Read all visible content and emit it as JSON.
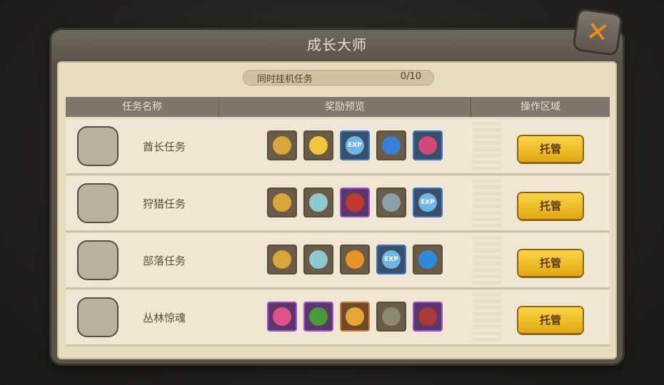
{
  "window": {
    "title": "成长大师"
  },
  "counter": {
    "label": "同时挂机任务",
    "value": "0/10"
  },
  "columns": [
    "任务名称",
    "奖励预览",
    "操作区域"
  ],
  "rows": [
    {
      "name": "酋长任务",
      "portrait_icon": "chief-stone-icon",
      "button": "托管",
      "rewards": [
        {
          "icon": "gold-chest-icon",
          "quality": "brown"
        },
        {
          "icon": "gold-hand-icon",
          "quality": "brown"
        },
        {
          "icon": "exp-heart-icon",
          "quality": "blue",
          "text": "EXP"
        },
        {
          "icon": "blue-feather-icon",
          "quality": "brown"
        },
        {
          "icon": "flower-gem-icon",
          "quality": "blue"
        }
      ]
    },
    {
      "name": "狩猎任务",
      "portrait_icon": "hunter-skull-icon",
      "button": "托管",
      "rewards": [
        {
          "icon": "gold-chest-icon",
          "quality": "brown"
        },
        {
          "icon": "shell-icon",
          "quality": "brown"
        },
        {
          "icon": "red-flower-icon",
          "quality": "purple"
        },
        {
          "icon": "spear-icon",
          "quality": "brown"
        },
        {
          "icon": "exp-heart-icon",
          "quality": "blue",
          "text": "EXP"
        }
      ]
    },
    {
      "name": "部落任务",
      "portrait_icon": "tribe-totem-icon",
      "button": "托管",
      "rewards": [
        {
          "icon": "gold-chest-icon",
          "quality": "brown"
        },
        {
          "icon": "shell-icon",
          "quality": "brown"
        },
        {
          "icon": "orange-gem-icon",
          "quality": "brown"
        },
        {
          "icon": "exp-heart-icon",
          "quality": "blue",
          "text": "EXP"
        },
        {
          "icon": "blue-puzzle-icon",
          "quality": "brown"
        }
      ]
    },
    {
      "name": "丛林惊魂",
      "portrait_icon": "jungle-beast-icon",
      "button": "托管",
      "rewards": [
        {
          "icon": "pink-mask-icon",
          "quality": "purple"
        },
        {
          "icon": "palm-tree-icon",
          "quality": "purple"
        },
        {
          "icon": "gold-box-icon",
          "quality": "orange"
        },
        {
          "icon": "stone-ring-icon",
          "quality": "brown"
        },
        {
          "icon": "red-branch-icon",
          "quality": "purple"
        }
      ]
    }
  ],
  "colors": {
    "purple_quality": "#a54bd0",
    "blue_quality": "#3c79c9",
    "orange_quality": "#d27c2c",
    "button_gold": "#fcd347",
    "close_orange": "#f08a1c"
  }
}
